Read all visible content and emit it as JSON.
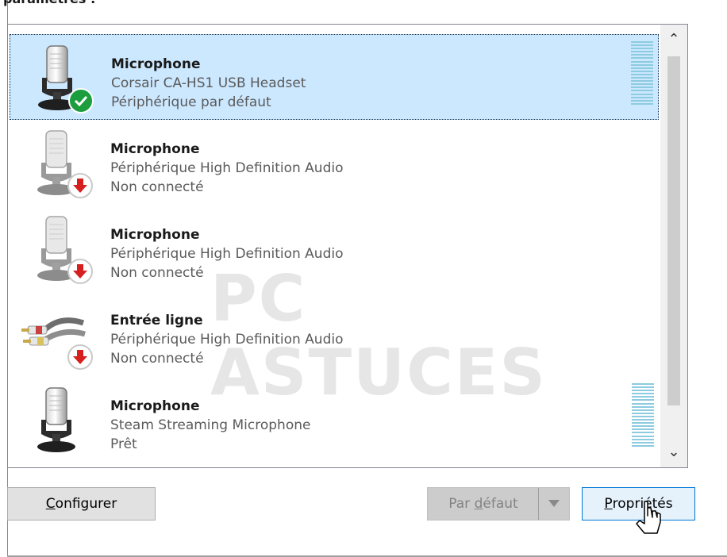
{
  "header": {
    "title_fragment": "paramètres :"
  },
  "devices": [
    {
      "name": "Microphone",
      "description": "Corsair CA-HS1 USB Headset",
      "status": "Périphérique par défaut",
      "icon": "microphone-icon",
      "badge": "check-icon",
      "selected": true,
      "level_meter": true
    },
    {
      "name": "Microphone",
      "description": "Périphérique High Definition Audio",
      "status": "Non connecté",
      "icon": "microphone-icon",
      "badge": "down-arrow-icon",
      "selected": false,
      "level_meter": false
    },
    {
      "name": "Microphone",
      "description": "Périphérique High Definition Audio",
      "status": "Non connecté",
      "icon": "microphone-icon",
      "badge": "down-arrow-icon",
      "selected": false,
      "level_meter": false
    },
    {
      "name": "Entrée ligne",
      "description": "Périphérique High Definition Audio",
      "status": "Non connecté",
      "icon": "line-in-cable-icon",
      "badge": "down-arrow-icon",
      "selected": false,
      "level_meter": false
    },
    {
      "name": "Microphone",
      "description": "Steam Streaming Microphone",
      "status": "Prêt",
      "icon": "microphone-icon",
      "badge": "",
      "selected": false,
      "level_meter": true
    }
  ],
  "buttons": {
    "configure": {
      "pre": "",
      "accel": "C",
      "post": "onfigurer"
    },
    "set_default": {
      "pre": "Par ",
      "accel": "d",
      "post": "éfaut"
    },
    "properties": {
      "pre": "",
      "accel": "P",
      "post": "ropriétés"
    }
  },
  "watermark": {
    "text": "PC ASTUCES"
  },
  "colors": {
    "selected_bg": "#cce8ff",
    "default_badge": "#1c9e3f",
    "disconnected_badge": "#d61f1f",
    "level_meter": "#8ccbe0"
  }
}
